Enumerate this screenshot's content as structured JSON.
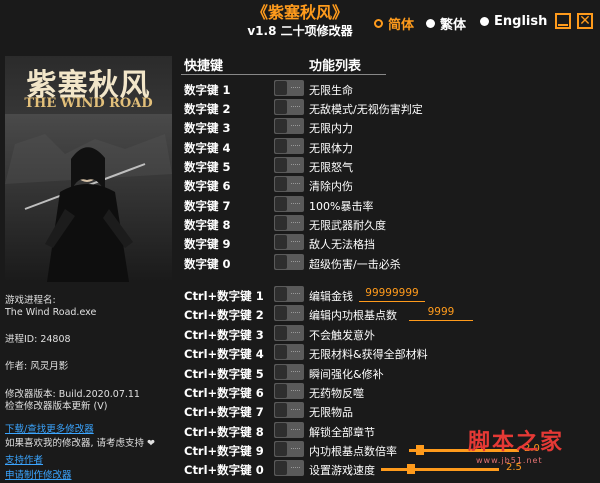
{
  "header": {
    "title": "《紫塞秋风》",
    "subtitle": "v1.8 二十项修改器"
  },
  "language": {
    "options": [
      {
        "label": "简体",
        "selected": true
      },
      {
        "label": "繁体",
        "selected": false
      },
      {
        "label": "English",
        "selected": false
      }
    ]
  },
  "cover": {
    "title_cn": "紫塞秋风",
    "title_en": "THE WIND ROAD"
  },
  "info": {
    "process_label": "游戏进程名:",
    "process_value": "The Wind Road.exe",
    "pid": "进程ID: 24808",
    "author": "作者: 风灵月影",
    "version": "修改器版本:  Build.2020.07.11",
    "check_update": "检查修改器版本更新 (V)",
    "download_more": "下载/查找更多修改器",
    "support_text": "如果喜欢我的修改器, 请考虑支持 ❤",
    "support_author": "支持作者",
    "request": "申请制作修改器"
  },
  "columns": {
    "hotkey": "快捷键",
    "function": "功能列表"
  },
  "rows": [
    {
      "key": "数字键 1",
      "func": "无限生命"
    },
    {
      "key": "数字键 2",
      "func": "无敌模式/无视伤害判定"
    },
    {
      "key": "数字键 3",
      "func": "无限内力"
    },
    {
      "key": "数字键 4",
      "func": "无限体力"
    },
    {
      "key": "数字键 5",
      "func": "无限怒气"
    },
    {
      "key": "数字键 6",
      "func": "清除内伤"
    },
    {
      "key": "数字键 7",
      "func": "100%暴击率"
    },
    {
      "key": "数字键 8",
      "func": "无限武器耐久度"
    },
    {
      "key": "数字键 9",
      "func": "敌人无法格挡"
    },
    {
      "key": "数字键 0",
      "func": "超级伤害/一击必杀"
    },
    {
      "key": "Ctrl+数字键 1",
      "func": "编辑金钱",
      "value": "99999999"
    },
    {
      "key": "Ctrl+数字键 2",
      "func": "编辑内功根基点数",
      "value": "9999"
    },
    {
      "key": "Ctrl+数字键 3",
      "func": "不会触发意外"
    },
    {
      "key": "Ctrl+数字键 4",
      "func": "无限材料&获得全部材料"
    },
    {
      "key": "Ctrl+数字键 5",
      "func": "瞬间强化&修补"
    },
    {
      "key": "Ctrl+数字键 6",
      "func": "无药物反噬"
    },
    {
      "key": "Ctrl+数字键 7",
      "func": "无限物品"
    },
    {
      "key": "Ctrl+数字键 8",
      "func": "解锁全部章节"
    },
    {
      "key": "Ctrl+数字键 9",
      "func": "内功根基点数倍率",
      "slider_value": "2.0",
      "slider_fraction": 0.1
    },
    {
      "key": "Ctrl+数字键 0",
      "func": "设置游戏速度",
      "slider_value": "2.5",
      "slider_fraction": 0.25
    }
  ],
  "watermark": {
    "text": "脚本之家",
    "url": "www.jb51.net"
  },
  "colors": {
    "accent": "#ff9b1c",
    "background": "#1a1a1a",
    "link": "#3ba5ff"
  }
}
